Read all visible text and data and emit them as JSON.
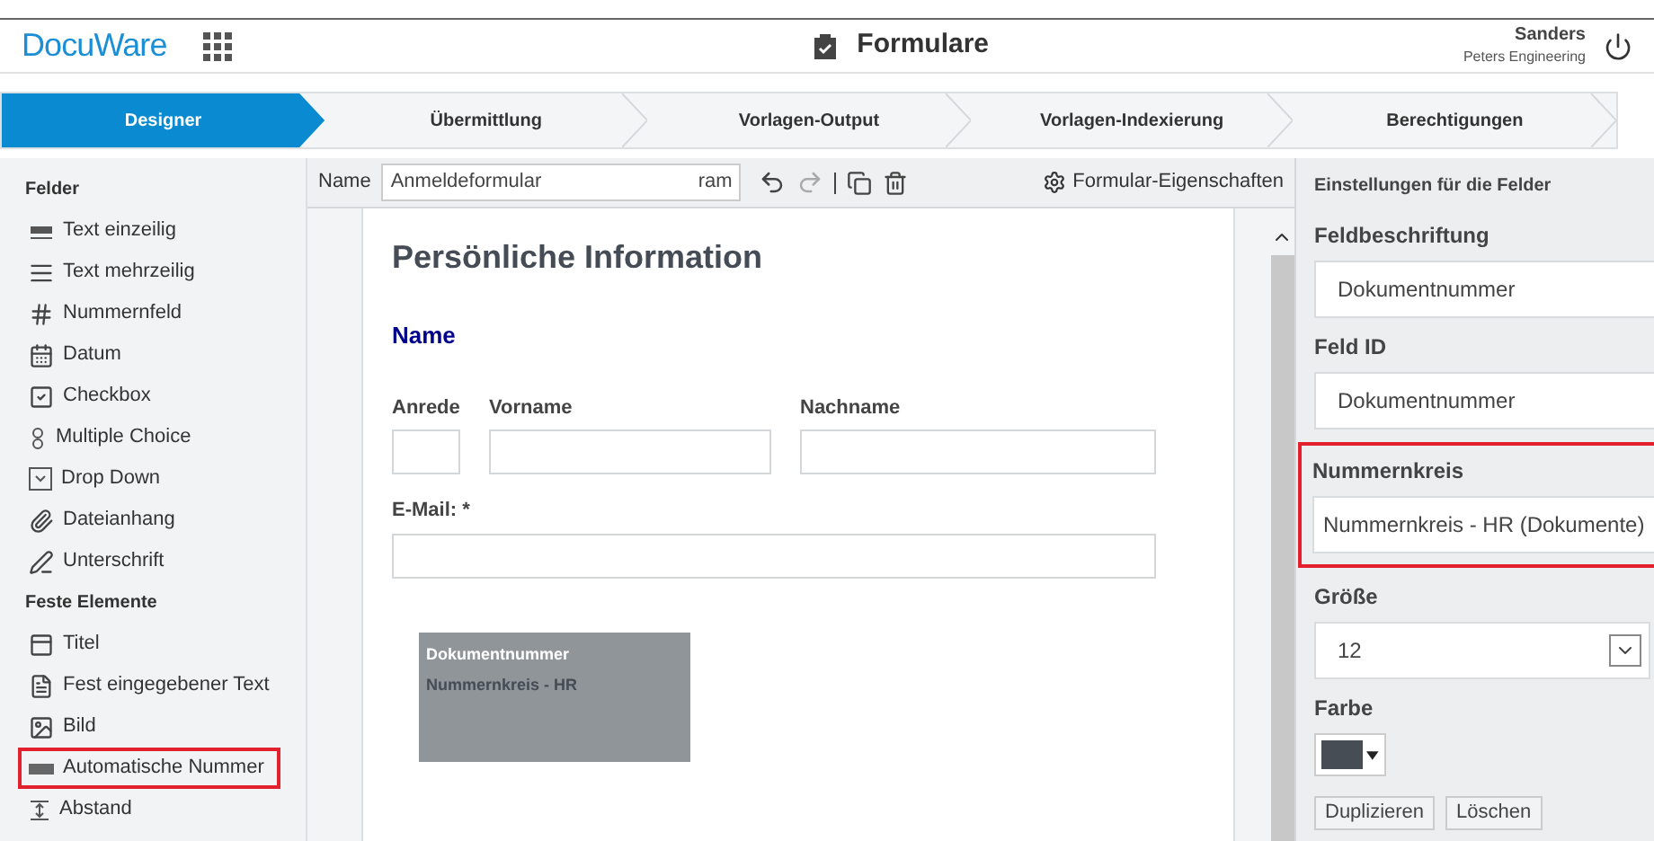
{
  "header": {
    "logo": "DocuWare",
    "title": "Formulare",
    "user": "Sanders",
    "company": "Peters Engineering"
  },
  "steps": [
    {
      "label": "Designer",
      "selected": true
    },
    {
      "label": "Übermittlung",
      "selected": false
    },
    {
      "label": "Vorlagen-Output",
      "selected": false
    },
    {
      "label": "Vorlagen-Indexierung",
      "selected": false
    },
    {
      "label": "Berechtigungen",
      "selected": false
    }
  ],
  "sidebar": {
    "sections": [
      {
        "title": "Felder",
        "items": [
          {
            "kind": "text",
            "label": "Text einzeilig",
            "selected": false
          },
          {
            "kind": "multiline",
            "label": "Text mehrzeilig",
            "selected": false
          },
          {
            "kind": "number",
            "label": "Nummernfeld",
            "selected": false
          },
          {
            "kind": "date",
            "label": "Datum",
            "selected": false
          },
          {
            "kind": "checkbox",
            "label": "Checkbox",
            "selected": false
          },
          {
            "kind": "choice",
            "label": "Multiple Choice",
            "selected": false
          },
          {
            "kind": "dropdown",
            "label": "Drop Down",
            "selected": false
          },
          {
            "kind": "attachment",
            "label": "Dateianhang",
            "selected": false
          },
          {
            "kind": "signature",
            "label": "Unterschrift",
            "selected": false
          }
        ]
      },
      {
        "title": "Feste Elemente",
        "items": [
          {
            "kind": "title",
            "label": "Titel",
            "selected": false
          },
          {
            "kind": "fixedtext",
            "label": "Fest eingegebener Text",
            "selected": false
          },
          {
            "kind": "image",
            "label": "Bild",
            "selected": false
          },
          {
            "kind": "autonumber",
            "label": "Automatische Nummer",
            "selected": true
          },
          {
            "kind": "spacing",
            "label": "Abstand",
            "selected": false
          }
        ]
      }
    ]
  },
  "toolbar": {
    "name_label": "Name",
    "name_value": "Anmeldeformular",
    "name_overflow": "ram",
    "properties": "Formular-Eigenschaften"
  },
  "form": {
    "heading": "Persönliche Information",
    "section": "Name",
    "rows": [
      [
        {
          "label": "Anrede",
          "kind": "short"
        },
        {
          "label": "Vorname",
          "kind": "medium"
        },
        {
          "label": "Nachname",
          "kind": "long"
        }
      ],
      [
        {
          "label": "E-Mail: *",
          "kind": "wide"
        }
      ]
    ],
    "autonumber": {
      "title": "Dokumentnummer",
      "value": "Nummernkreis - HR"
    }
  },
  "settings": {
    "title": "Einstellungen für die Felder",
    "fields": [
      {
        "kind": "text",
        "label": "Feldbeschriftung",
        "value": "Dokumentnummer",
        "highlighted": false
      },
      {
        "kind": "text",
        "label": "Feld ID",
        "value": "Dokumentnummer",
        "highlighted": false
      },
      {
        "kind": "combo",
        "label": "Nummernkreis",
        "value": "Nummernkreis - HR (Dokumente)",
        "highlighted": true
      },
      {
        "kind": "select",
        "label": "Größe",
        "value": "12",
        "highlighted": false
      },
      {
        "kind": "color",
        "label": "Farbe",
        "color": "#474d55",
        "highlighted": false
      }
    ],
    "buttons": [
      "Duplizieren",
      "Löschen"
    ]
  }
}
